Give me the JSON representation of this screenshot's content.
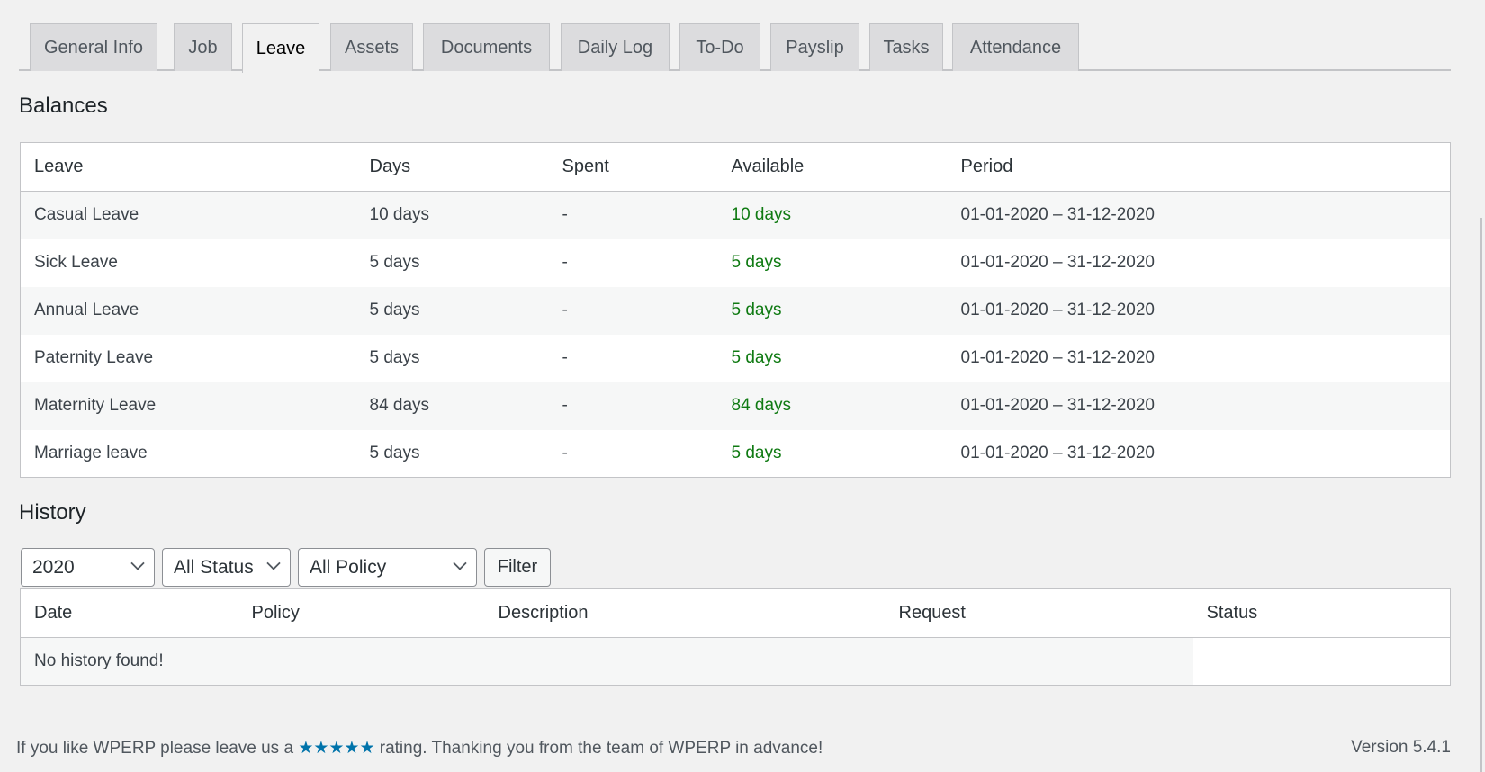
{
  "tabs": [
    "General Info",
    "Job",
    "Leave",
    "Assets",
    "Documents",
    "Daily Log",
    "To-Do",
    "Payslip",
    "Tasks",
    "Attendance"
  ],
  "active_tab": "Leave",
  "balances": {
    "title": "Balances",
    "headers": [
      "Leave",
      "Days",
      "Spent",
      "Available",
      "Period"
    ],
    "rows": [
      [
        "Casual Leave",
        "10 days",
        "-",
        "10 days",
        "01-01-2020 – 31-12-2020"
      ],
      [
        "Sick Leave",
        "5 days",
        "-",
        "5 days",
        "01-01-2020 – 31-12-2020"
      ],
      [
        "Annual Leave",
        "5 days",
        "-",
        "5 days",
        "01-01-2020 – 31-12-2020"
      ],
      [
        "Paternity Leave",
        "5 days",
        "-",
        "5 days",
        "01-01-2020 – 31-12-2020"
      ],
      [
        "Maternity Leave",
        "84 days",
        "-",
        "84 days",
        "01-01-2020 – 31-12-2020"
      ],
      [
        "Marriage leave",
        "5 days",
        "-",
        "5 days",
        "01-01-2020 – 31-12-2020"
      ]
    ]
  },
  "history": {
    "title": "History",
    "year": "2020",
    "status": "All Status",
    "policy": "All Policy",
    "filter_label": "Filter",
    "headers": [
      "Date",
      "Policy",
      "Description",
      "Request",
      "Status"
    ],
    "empty": "No history found!"
  },
  "footer": {
    "pre": "If you like WPERP please leave us a ",
    "stars": "★★★★★",
    "post": " rating. Thanking you from the team of WPERP in advance!",
    "version": "Version 5.4.1"
  },
  "colors": {
    "available": "#0f7a12",
    "stars": "#0073aa"
  }
}
